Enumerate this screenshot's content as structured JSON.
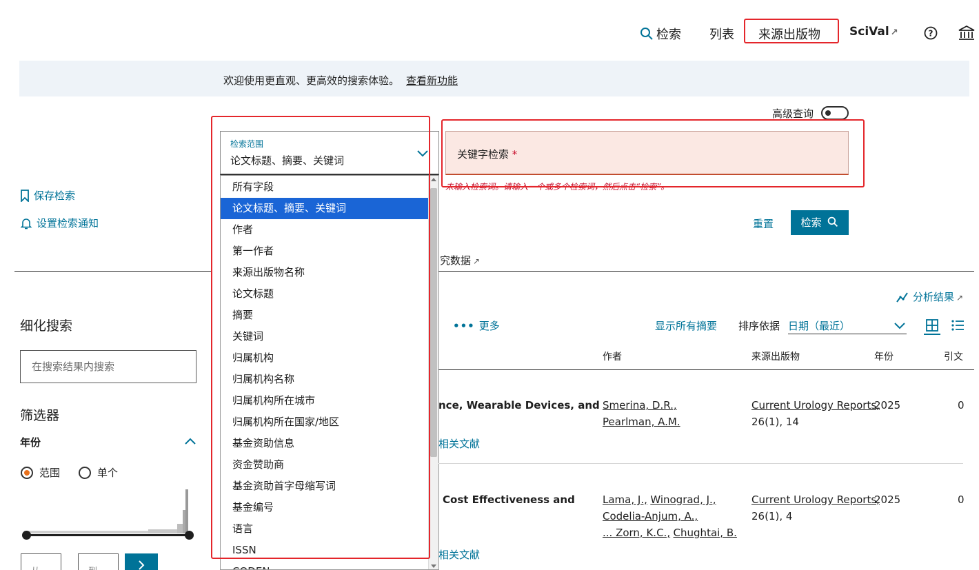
{
  "nav": {
    "search": "检索",
    "lists": "列表",
    "sources": "来源出版物",
    "scival": "SciVal",
    "help_icon": "question-circle-icon",
    "institution_icon": "institution-icon"
  },
  "banner": {
    "text": "欢迎使用更直观、更高效的搜索体验。",
    "link": "查看新功能"
  },
  "advanced": {
    "label": "高级查询",
    "enabled": false
  },
  "scope": {
    "caption": "检索范围",
    "value": "论文标题、摘要、关键词",
    "options": [
      "所有字段",
      "论文标题、摘要、关键词",
      "作者",
      "第一作者",
      "来源出版物名称",
      "论文标题",
      "摘要",
      "关键词",
      "归属机构",
      "归属机构名称",
      "归属机构所在城市",
      "归属机构所在国家/地区",
      "基金资助信息",
      "资金赞助商",
      "基金资助首字母缩写词",
      "基金编号",
      "语言",
      "ISSN",
      "CODEN"
    ],
    "selected_index": 1
  },
  "keyword": {
    "label": "关键字检索",
    "required_mark": "*",
    "error": "未输入检索词。请输入一个或多个检索词，然后点击“检索”。"
  },
  "actions": {
    "reset": "重置",
    "search": "检索"
  },
  "sidebar": {
    "save_search": "保存检索",
    "set_alert": "设置检索通知",
    "refine_title": "细化搜索",
    "refine_placeholder": "在搜索结果内搜索",
    "filters_title": "筛选器",
    "year_title": "年份",
    "radio_range": "范围",
    "radio_single": "单个",
    "from_placeholder": "从",
    "to_placeholder": "到"
  },
  "tabs": {
    "research_data_fragment": "究数据"
  },
  "results_toolbar": {
    "analyze": "分析结果",
    "more": "更多",
    "show_abstracts": "显示所有摘要",
    "sort_label": "排序依据",
    "sort_value": "日期（最近）"
  },
  "columns": {
    "authors": "作者",
    "source": "来源出版物",
    "year": "年份",
    "citations": "引文"
  },
  "results": [
    {
      "title_fragment": "nce, Wearable Devices, and",
      "authors": [
        "Smerina, D.R.,",
        "Pearlman, A.M."
      ],
      "source": "Current Urology Reports,",
      "source_detail": "26(1), 14",
      "year": "2025",
      "citations": "0",
      "related": "相关文献"
    },
    {
      "title_fragment": "Cost Effectiveness and",
      "authors": [
        "Lama, J.,",
        "Winograd, J.,",
        "Codelia-Anjum, A.,",
        "... Zorn, K.C.,",
        "Chughtai, B."
      ],
      "source": "Current Urology Reports,",
      "source_detail": "26(1), 4",
      "year": "2025",
      "citations": "0",
      "related": "相关文献"
    }
  ],
  "colors": {
    "accent": "#007398",
    "highlight": "#e4262b",
    "selected": "#1a65d6",
    "error": "#c8102e"
  }
}
